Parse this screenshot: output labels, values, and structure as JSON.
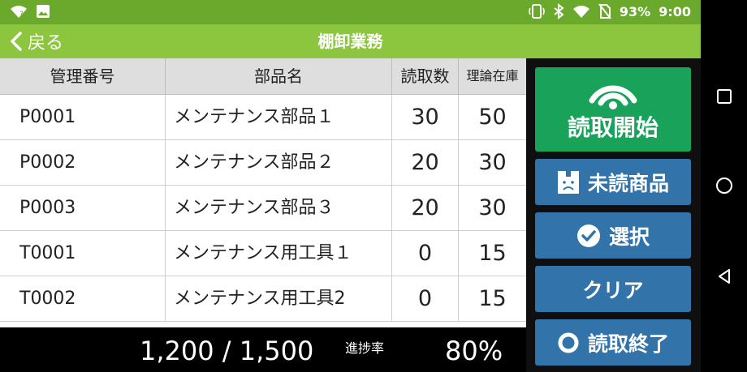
{
  "status_bar": {
    "battery": "93%",
    "time": "9:00"
  },
  "app_bar": {
    "back_label": "戻る",
    "title": "棚卸業務"
  },
  "table": {
    "headers": [
      "管理番号",
      "部品名",
      "読取数",
      "理論在庫"
    ],
    "rows": [
      {
        "id": "P0001",
        "name": "メンテナンス部品１",
        "read": "30",
        "stock": "50"
      },
      {
        "id": "P0002",
        "name": "メンテナンス部品２",
        "read": "20",
        "stock": "30"
      },
      {
        "id": "P0003",
        "name": "メンテナンス部品３",
        "read": "20",
        "stock": "30"
      },
      {
        "id": "T0001",
        "name": "メンテナンス用工具１",
        "read": "0",
        "stock": "15"
      },
      {
        "id": "T0002",
        "name": "メンテナンス用工具2",
        "read": "0",
        "stock": "15"
      }
    ]
  },
  "footer": {
    "count": "1,200 / 1,500",
    "progress_label": "進捗率",
    "progress": "80%"
  },
  "buttons": {
    "start": "読取開始",
    "unread": "未読商品",
    "select": "選択",
    "clear": "クリア",
    "stop": "読取終了"
  },
  "colors": {
    "status_bar": "#6aa92b",
    "app_bar": "#8cc63f",
    "start_button": "#19a35a",
    "action_button": "#3274a9"
  },
  "icons": [
    "wifi-question-icon",
    "image-icon",
    "nfc-icon",
    "bluetooth-icon",
    "wifi-icon",
    "no-sim-icon",
    "back-chevron-icon",
    "signal-waves-icon",
    "unread-box-icon",
    "check-circle-icon",
    "ring-icon",
    "recents-icon",
    "home-icon",
    "back-triangle-icon"
  ]
}
